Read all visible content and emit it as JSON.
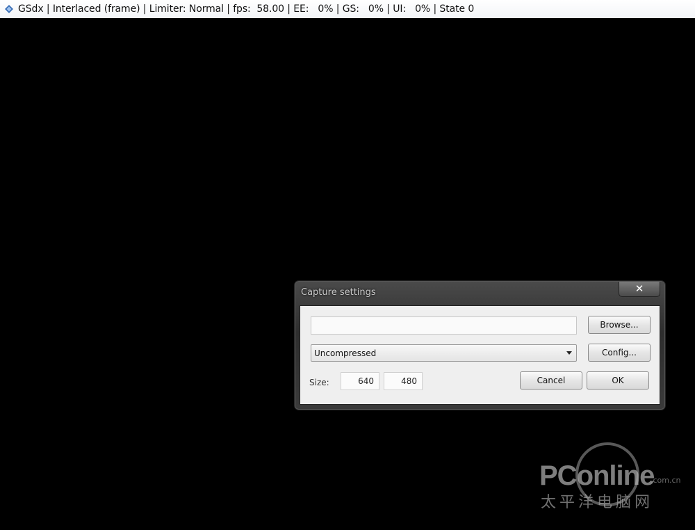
{
  "window": {
    "title": "GSdx | Interlaced (frame) | Limiter: Normal | fps:  58.00 | EE:   0% | GS:   0% | UI:   0% | State 0",
    "icon": "gsdx-app-icon"
  },
  "dialog": {
    "title": "Capture settings",
    "close_label": "✕",
    "path_value": "",
    "browse_label": "Browse...",
    "codec_value": "Uncompressed",
    "config_label": "Config...",
    "size_label": "Size:",
    "width_value": "640",
    "height_value": "480",
    "cancel_label": "Cancel",
    "ok_label": "OK"
  },
  "watermark": {
    "logo": "PConline",
    "domain": ".com.cn",
    "chinese": "太平洋电脑网"
  },
  "colors": {
    "screen_background": "#000000",
    "dialog_frame": "#3a3a3a",
    "dialog_client": "#efefef"
  }
}
